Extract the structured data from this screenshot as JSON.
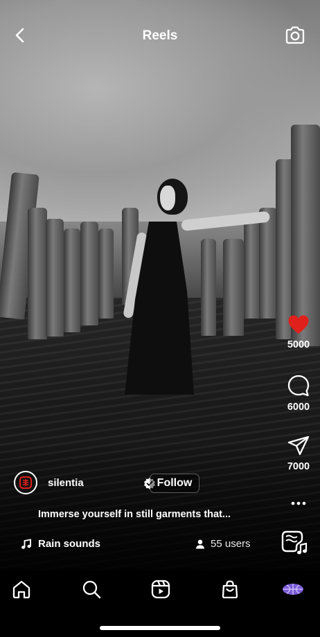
{
  "header": {
    "title": "Reels"
  },
  "post": {
    "author": {
      "username": "silentia",
      "verified": true
    },
    "follow_label": "Follow",
    "caption": "Immerse yourself in still garments that...",
    "audio": {
      "title": "Rain sounds",
      "users_label": "55 users"
    }
  },
  "actions": {
    "likes": "5000",
    "comments": "6000",
    "shares": "7000",
    "liked": true
  },
  "nav": {
    "items": [
      "home",
      "search",
      "reels",
      "shop",
      "profile"
    ]
  },
  "colors": {
    "like": "#e0201b",
    "profile_accent": "#7b5cd6"
  },
  "icons": [
    "chevron-left-icon",
    "camera-icon",
    "heart-icon",
    "comment-icon",
    "send-icon",
    "more-icon",
    "music-note-icon",
    "user-icon",
    "home-icon",
    "search-icon",
    "reels-icon",
    "shopping-bag-icon",
    "profile-globe-icon"
  ]
}
